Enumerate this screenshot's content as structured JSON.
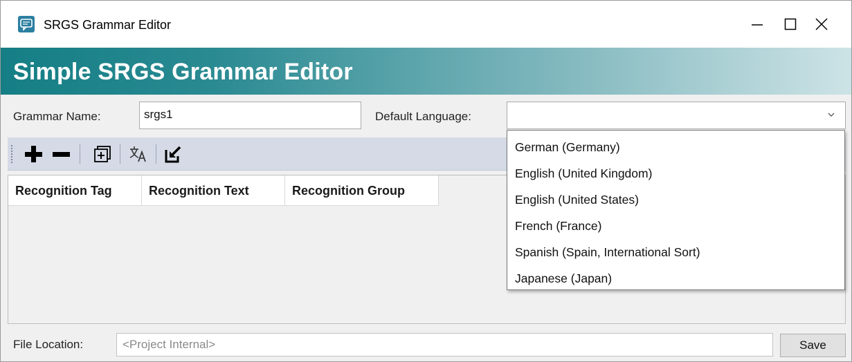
{
  "window": {
    "title": "SRGS Grammar Editor"
  },
  "banner": {
    "title": "Simple SRGS Grammar Editor"
  },
  "form": {
    "grammar_name_label": "Grammar Name:",
    "grammar_name_value": "srgs1",
    "default_language_label": "Default Language:",
    "default_language_value": ""
  },
  "toolbar": {
    "icons": [
      "plus-icon",
      "minus-icon",
      "add-group-icon",
      "translate-icon",
      "export-icon"
    ]
  },
  "grid": {
    "columns": [
      "Recognition Tag",
      "Recognition Text",
      "Recognition Group"
    ],
    "rows": []
  },
  "language_dropdown": {
    "options": [
      "German (Germany)",
      "English (United Kingdom)",
      "English (United States)",
      "French (France)",
      "Spanish (Spain, International Sort)",
      "Japanese (Japan)"
    ]
  },
  "footer": {
    "file_location_label": "File Location:",
    "file_location_placeholder": "<Project Internal>",
    "save_label": "Save"
  },
  "colors": {
    "banner_start": "#157e85",
    "banner_end": "#cde3e6",
    "toolbar": "#d5dae6"
  }
}
